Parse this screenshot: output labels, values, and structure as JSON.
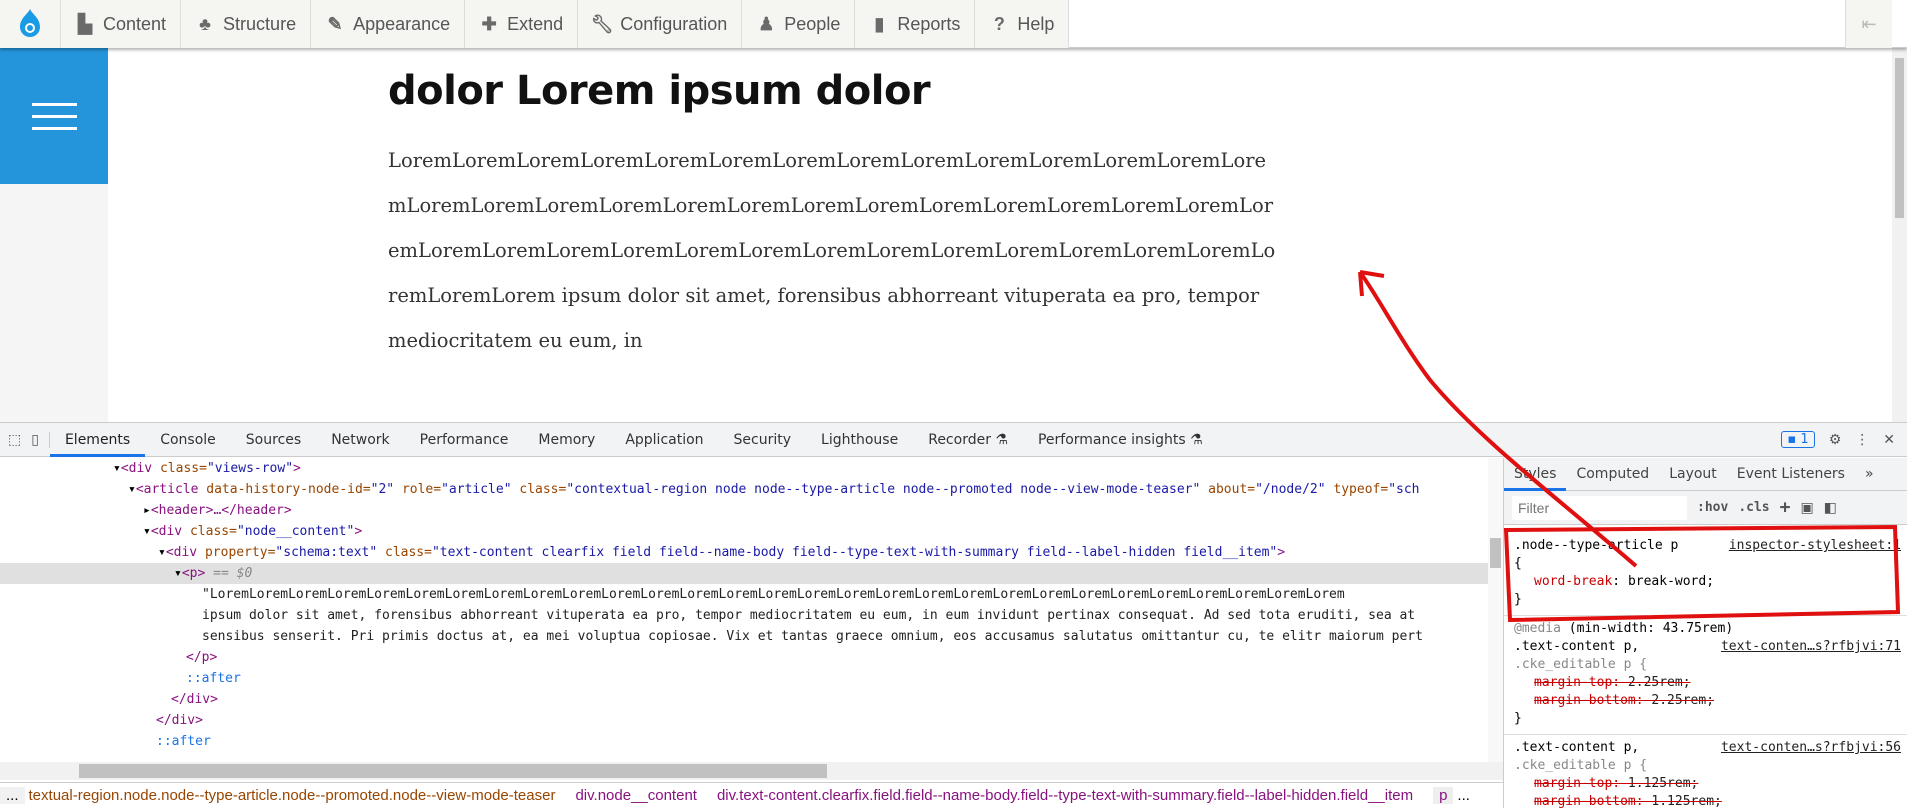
{
  "toolbar": {
    "items": [
      {
        "label": "Content",
        "icon": "file-icon"
      },
      {
        "label": "Structure",
        "icon": "sitemap-icon"
      },
      {
        "label": "Appearance",
        "icon": "brush-icon"
      },
      {
        "label": "Extend",
        "icon": "puzzle-icon"
      },
      {
        "label": "Configuration",
        "icon": "wrench-icon"
      },
      {
        "label": "People",
        "icon": "people-icon"
      },
      {
        "label": "Reports",
        "icon": "bar-chart-icon"
      },
      {
        "label": "Help",
        "icon": "help-icon"
      }
    ],
    "toggle": "⇤"
  },
  "page": {
    "title": "dolor Lorem ipsum dolor",
    "body": "LoremLoremLoremLoremLoremLoremLoremLoremLoremLoremLoremLoremLoremLoremLoremLoremLoremLoremLoremLoremLoremLoremLoremLoremLoremLoremLoremLoremLoremLoremLoremLoremLoremLoremLoremLoremLoremLoremLoremLoremLoremLoremLoremLorem ipsum dolor sit amet, forensibus abhorreant vituperata ea pro, tempor mediocritatem eu eum, in"
  },
  "devtools": {
    "tabs": [
      "Elements",
      "Console",
      "Sources",
      "Network",
      "Performance",
      "Memory",
      "Application",
      "Security",
      "Lighthouse",
      "Recorder ⚗",
      "Performance insights ⚗"
    ],
    "issues_count": "1",
    "dom": {
      "r1": [
        "<div",
        " class=",
        "\"views-row\"",
        ">"
      ],
      "r2": [
        "<article",
        " data-history-node-id=",
        "\"2\"",
        " role=",
        "\"article\"",
        " class=",
        "\"contextual-region node node--type-article node--promoted node--view-mode-teaser\"",
        " about=",
        "\"/node/2\"",
        " typeof=",
        "\"sch"
      ],
      "r3": "<header>…</header>",
      "r4": [
        "<div",
        " class=",
        "\"node__content\"",
        ">"
      ],
      "r5": [
        "<div",
        " property=",
        "\"schema:text\"",
        " class=",
        "\"text-content clearfix field field--name-body field--type-text-with-summary field--label-hidden field__item\"",
        ">"
      ],
      "r6": [
        "<p>",
        " == $0"
      ],
      "t1": "\"LoremLoremLoremLoremLoremLoremLoremLoremLoremLoremLoremLoremLoremLoremLoremLoremLoremLoremLoremLoremLoremLoremLoremLoremLoremLoremLoremLoremLorem",
      "t2": "ipsum dolor sit amet, forensibus abhorreant vituperata ea pro, tempor mediocritatem eu eum, in eum invidunt pertinax consequat. Ad sed tota eruditi, sea at",
      "t3": "sensibus senserit. Pri primis doctus at, ea mei voluptua copiosae. Vix et tantas graece omnium, eos accusamus salutatus omittantur cu, te elitr maiorum pert",
      "c1": "</p>",
      "a1": "::after",
      "c2": "</div>",
      "c3": "</div>",
      "a2": "::after"
    },
    "breadcrumbs": [
      "...",
      "textual-region.node.node--type-article.node--promoted.node--view-mode-teaser",
      "div.node__content",
      "div.text-content.clearfix.field.field--name-body.field--type-text-with-summary.field--label-hidden.field__item",
      "p",
      "..."
    ],
    "styles_tabs": [
      "Styles",
      "Computed",
      "Layout",
      "Event Listeners",
      "»"
    ],
    "filter_placeholder": "Filter",
    "hov": ":hov",
    "cls": ".cls",
    "plus": "+",
    "rules": [
      {
        "selector": ".node--type-article p",
        "source": "inspector-stylesheet:1",
        "open": "{",
        "prop": "word-break",
        "value": "break-word;",
        "close": "}"
      },
      {
        "media": "@media",
        "media_q": "(min-width: 43.75rem)",
        "selector": ".text-content p,",
        "selector2": ".cke_editable p {",
        "source": "text-conten…s?rfbjvi:71",
        "p1": "margin-top:",
        "v1": "2.25rem;",
        "p2": "margin-bottom:",
        "v2": "2.25rem;",
        "close": "}"
      },
      {
        "selector": ".text-content p,",
        "selector2": ".cke_editable p {",
        "source": "text-conten…s?rfbjvi:56",
        "p1": "margin-top:",
        "v1": "1.125rem;",
        "p2": "margin-bottom:",
        "v2": "1.125rem;"
      }
    ]
  },
  "colors": {
    "accent": "#2494db",
    "annotation": "#e01010"
  }
}
